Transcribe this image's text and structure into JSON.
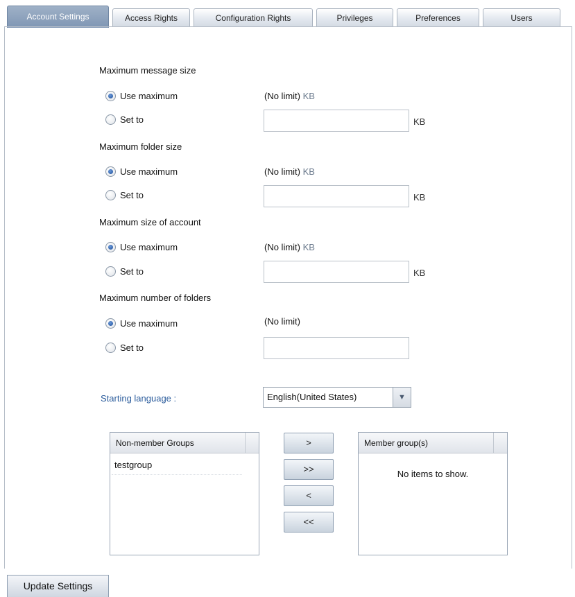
{
  "tabs": [
    {
      "label": "Account Settings",
      "active": true
    },
    {
      "label": "Access Rights",
      "active": false
    },
    {
      "label": "Configuration Rights",
      "active": false
    },
    {
      "label": "Privileges",
      "active": false
    },
    {
      "label": "Preferences",
      "active": false
    },
    {
      "label": "Users",
      "active": false
    }
  ],
  "sections": [
    {
      "title": "Maximum message size",
      "use_max_label": "Use maximum",
      "set_to_label": "Set to",
      "limit_text": "(No limit)",
      "unit": "KB",
      "selected": "use_maximum",
      "set_to_value": ""
    },
    {
      "title": "Maximum folder size",
      "use_max_label": "Use maximum",
      "set_to_label": "Set to",
      "limit_text": "(No limit)",
      "unit": "KB",
      "selected": "use_maximum",
      "set_to_value": ""
    },
    {
      "title": "Maximum size of account",
      "use_max_label": "Use maximum",
      "set_to_label": "Set to",
      "limit_text": "(No limit)",
      "unit": "KB",
      "selected": "use_maximum",
      "set_to_value": ""
    },
    {
      "title": "Maximum number of folders",
      "use_max_label": "Use maximum",
      "set_to_label": "Set to",
      "limit_text": "(No limit)",
      "unit": "",
      "selected": "use_maximum",
      "set_to_value": ""
    }
  ],
  "language": {
    "label": "Starting language :",
    "selected": "English(United States)"
  },
  "non_member_groups": {
    "header": "Non-member Groups",
    "items": [
      "testgroup"
    ]
  },
  "member_groups": {
    "header": "Member group(s)",
    "empty_text": "No items to show."
  },
  "move_buttons": {
    "add": ">",
    "add_all": ">>",
    "remove": "<",
    "remove_all": "<<"
  },
  "update_button": "Update Settings",
  "colors": {
    "active_tab": "#8aa0bd",
    "link_label": "#2b5c9c",
    "radio_selected": "#1d4f9a"
  },
  "icons": {
    "select_arrow": "chevron-down-icon"
  }
}
